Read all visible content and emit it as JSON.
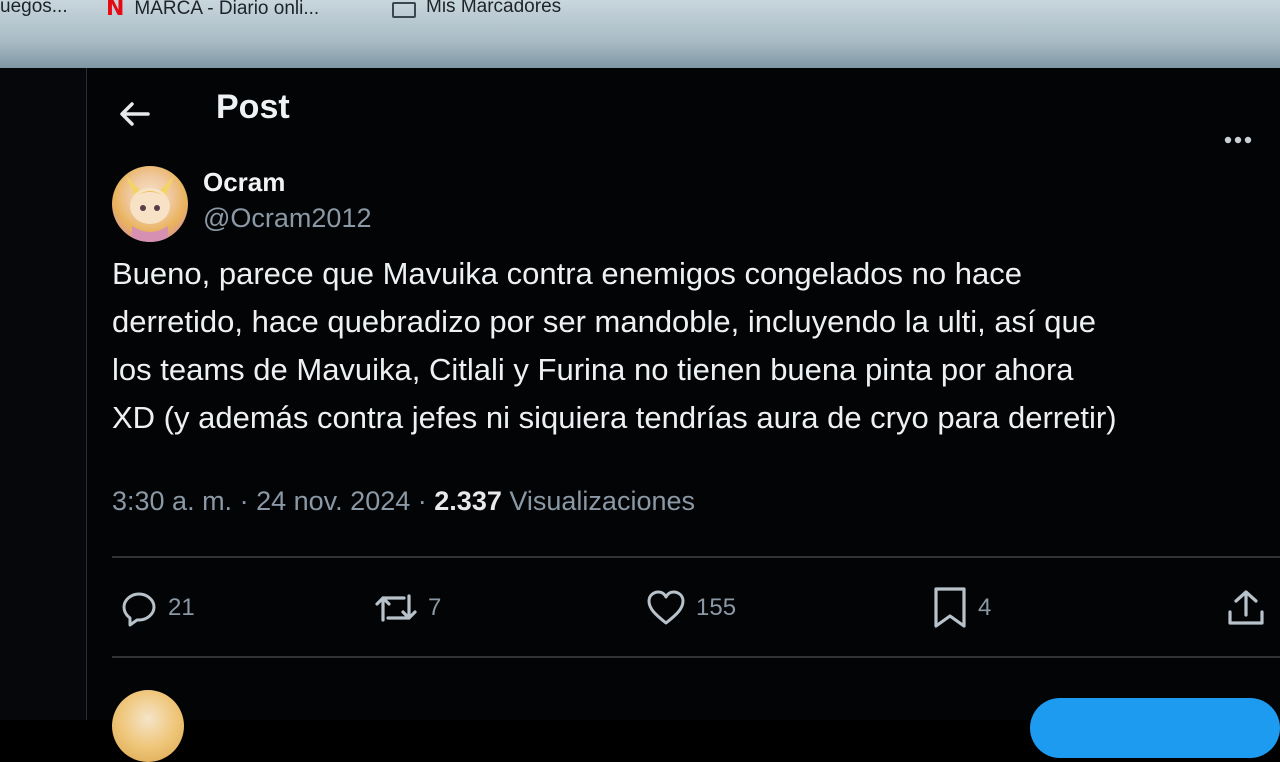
{
  "bookmarks": {
    "items": [
      {
        "label": "uegos..."
      },
      {
        "label": "MARCA - Diario onli...",
        "icon": "N"
      },
      {
        "label": "Mis Marcadores"
      }
    ]
  },
  "header": {
    "title": "Post"
  },
  "tweet": {
    "display_name": "Ocram",
    "handle": "@Ocram2012",
    "text_lines": [
      "Bueno, parece que Mavuika contra enemigos congelados no hace",
      "derretido, hace quebradizo por ser mandoble, incluyendo la ulti, así que",
      "los teams de Mavuika, Citlali y Furina no tienen buena pinta por ahora",
      "XD (y además contra jefes ni siquiera tendrías aura de cryo para derretir)"
    ],
    "time": "3:30 a. m.",
    "date": "24 nov. 2024",
    "views_count": "2.337",
    "views_label": "Visualizaciones",
    "separator": "·"
  },
  "actions": {
    "replies": "21",
    "reposts": "7",
    "likes": "155",
    "bookmarks": "4"
  },
  "colors": {
    "background": "#030405",
    "text": "#e7e9ea",
    "muted": "#8b98a5",
    "divider": "#2f3336",
    "accent": "#1d9bf0"
  }
}
